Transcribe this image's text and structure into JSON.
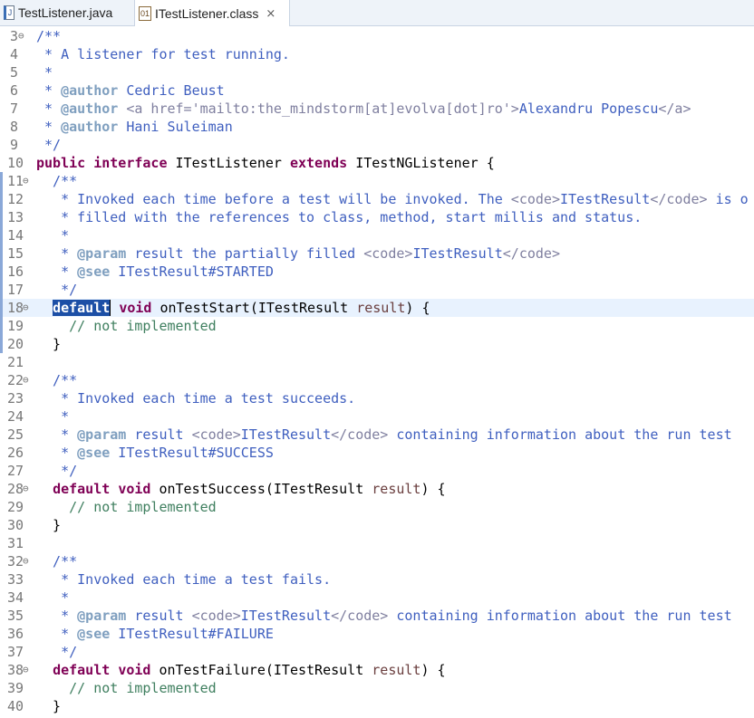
{
  "tabs": [
    {
      "label": "TestListener.java"
    },
    {
      "label": "ITestListener.class",
      "close": "⨯"
    }
  ],
  "lines": [
    {
      "n": "3",
      "code": "/**"
    },
    {
      "n": "4",
      "code": " * A listener for test running."
    },
    {
      "n": "5",
      "code": " *"
    },
    {
      "n": "6",
      "code": " * @author Cedric Beust"
    },
    {
      "n": "7",
      "code": " * @author <a href='mailto:the_mindstorm[at]evolva[dot]ro'>Alexandru Popescu</a>"
    },
    {
      "n": "8",
      "code": " * @author Hani Suleiman"
    },
    {
      "n": "9",
      "code": " */"
    },
    {
      "n": "10",
      "code": "public interface ITestListener extends ITestNGListener {"
    },
    {
      "n": "11",
      "code": "  /**"
    },
    {
      "n": "12",
      "code": "   * Invoked each time before a test will be invoked. The <code>ITestResult</code> is o"
    },
    {
      "n": "13",
      "code": "   * filled with the references to class, method, start millis and status."
    },
    {
      "n": "14",
      "code": "   *"
    },
    {
      "n": "15",
      "code": "   * @param result the partially filled <code>ITestResult</code>"
    },
    {
      "n": "16",
      "code": "   * @see ITestResult#STARTED"
    },
    {
      "n": "17",
      "code": "   */"
    },
    {
      "n": "18",
      "code": "  default void onTestStart(ITestResult result) {"
    },
    {
      "n": "19",
      "code": "    // not implemented"
    },
    {
      "n": "20",
      "code": "  }"
    },
    {
      "n": "21",
      "code": ""
    },
    {
      "n": "22",
      "code": "  /**"
    },
    {
      "n": "23",
      "code": "   * Invoked each time a test succeeds."
    },
    {
      "n": "24",
      "code": "   *"
    },
    {
      "n": "25",
      "code": "   * @param result <code>ITestResult</code> containing information about the run test"
    },
    {
      "n": "26",
      "code": "   * @see ITestResult#SUCCESS"
    },
    {
      "n": "27",
      "code": "   */"
    },
    {
      "n": "28",
      "code": "  default void onTestSuccess(ITestResult result) {"
    },
    {
      "n": "29",
      "code": "    // not implemented"
    },
    {
      "n": "30",
      "code": "  }"
    },
    {
      "n": "31",
      "code": ""
    },
    {
      "n": "32",
      "code": "  /**"
    },
    {
      "n": "33",
      "code": "   * Invoked each time a test fails."
    },
    {
      "n": "34",
      "code": "   *"
    },
    {
      "n": "35",
      "code": "   * @param result <code>ITestResult</code> containing information about the run test"
    },
    {
      "n": "36",
      "code": "   * @see ITestResult#FAILURE"
    },
    {
      "n": "37",
      "code": "   */"
    },
    {
      "n": "38",
      "code": "  default void onTestFailure(ITestResult result) {"
    },
    {
      "n": "39",
      "code": "    // not implemented"
    },
    {
      "n": "40",
      "code": "  }"
    }
  ],
  "fold_marker": "⊖",
  "current_line": "18",
  "selected_token": "default",
  "colors": {
    "keyword": "#7f0055",
    "javadoc": "#3f5fbf",
    "javadoc_tag": "#7f9fbf",
    "html_tag": "#7f7f9f",
    "line_comment": "#3f7f5f",
    "selection": "#1c4fa6"
  }
}
